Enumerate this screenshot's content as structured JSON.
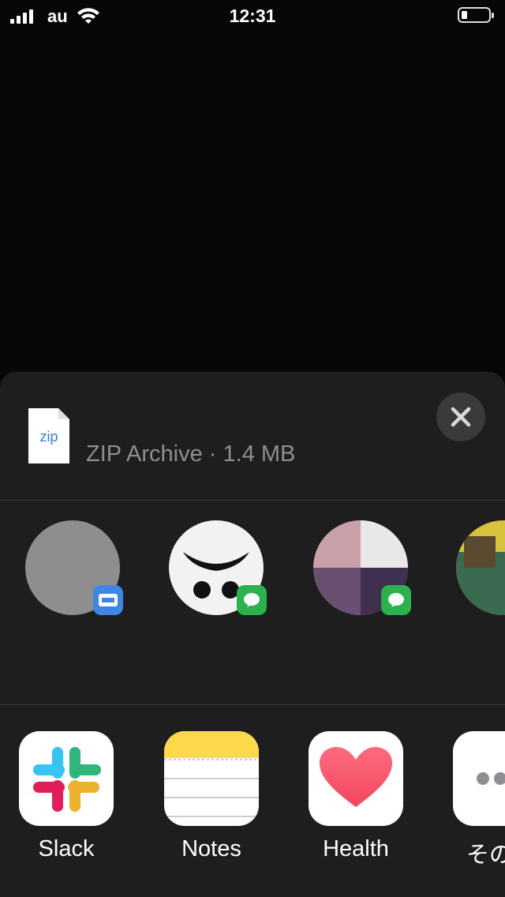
{
  "status_bar": {
    "carrier": "au",
    "time": "12:31",
    "icons": [
      "signal-icon",
      "wifi-icon",
      "battery-icon"
    ]
  },
  "share_sheet": {
    "file_icon_label": "zip",
    "file_title": "ZIP Archive · 1.4 MB",
    "close_icon": "close-icon",
    "contacts": [
      {
        "name": "",
        "avatar_color": "#8e8e8e",
        "badge_app": "blue-app-icon"
      },
      {
        "name": "",
        "avatar_color": "#f2f2f2",
        "badge_app": "line-icon"
      },
      {
        "name": "",
        "avatar_color": "#9a8aa8",
        "badge_app": "line-icon"
      },
      {
        "name": "",
        "avatar_color": "#d8c23a",
        "badge_app": "none"
      }
    ],
    "apps": [
      {
        "label": "Slack",
        "icon": "slack-icon"
      },
      {
        "label": "Notes",
        "icon": "notes-icon"
      },
      {
        "label": "Health",
        "icon": "health-heart-icon"
      },
      {
        "label": "その",
        "icon": "more-icon"
      }
    ]
  },
  "colors": {
    "sheet_bg": "#1e1e1e",
    "divider": "#3a3a3c",
    "line_green": "#2bb24c",
    "health_pink": "#f2475f"
  }
}
